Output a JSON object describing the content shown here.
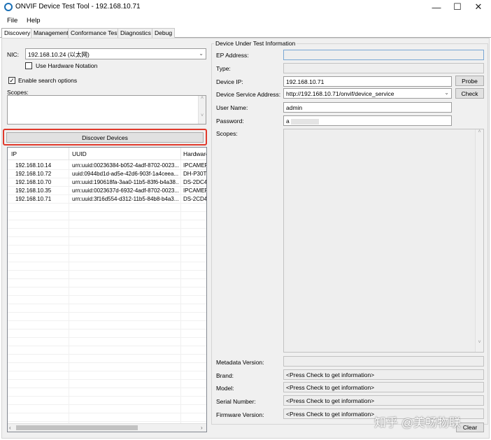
{
  "window": {
    "title": "ONVIF Device Test Tool - 192.168.10.71"
  },
  "menubar": {
    "file": "File",
    "help": "Help"
  },
  "tabs": [
    {
      "label": "Discovery"
    },
    {
      "label": "Management"
    },
    {
      "label": "Conformance Test"
    },
    {
      "label": "Diagnostics"
    },
    {
      "label": "Debug"
    }
  ],
  "discovery": {
    "nic_label": "NIC:",
    "nic_value": "192.168.10.24 (以太网)",
    "use_hw_notation": "Use Hardware Notation",
    "enable_search": "Enable search options",
    "scopes_label": "Scopes:",
    "discover_button": "Discover Devices",
    "columns": [
      "IP",
      "UUID",
      "Hardware"
    ],
    "devices": [
      {
        "ip": "192.168.10.14",
        "uuid": "urn:uuid:00236384-b052-4adf-8702-0023...",
        "hw": "IPCAMERA"
      },
      {
        "ip": "192.168.10.72",
        "uuid": "uuid:0944bd1d-ad5e-42d6-903f-1a4ceea...",
        "hw": "DH-P30T"
      },
      {
        "ip": "192.168.10.70",
        "uuid": "urn:uuid:190618fa-3aa0-11b5-83f6-b4a38...",
        "hw": "DS-2DC4"
      },
      {
        "ip": "192.168.10.35",
        "uuid": "urn:uuid:0023637d-6932-4adf-8702-0023...",
        "hw": "IPCAMERA"
      },
      {
        "ip": "192.168.10.71",
        "uuid": "urn:uuid:3f16d554-d312-11b5-84b8-b4a3...",
        "hw": "DS-2CD4"
      }
    ]
  },
  "dut": {
    "group_title": "Device Under Test Information",
    "ep_address_label": "EP Address:",
    "type_label": "Type:",
    "device_ip_label": "Device IP:",
    "device_ip_value": "192.168.10.71",
    "probe_button": "Probe",
    "service_address_label": "Device Service Address:",
    "service_address_value": "http://192.168.10.71/onvif/device_service",
    "check_button": "Check",
    "username_label": "User Name:",
    "username_value": "admin",
    "password_label": "Password:",
    "password_value": "a",
    "scopes_label": "Scopes:",
    "metadata_label": "Metadata Version:",
    "brand_label": "Brand:",
    "brand_value": "<Press Check to get information>",
    "model_label": "Model:",
    "model_value": "<Press Check to get information>",
    "serial_label": "Serial Number:",
    "serial_value": "<Press Check to get information>",
    "firmware_label": "Firmware Version:",
    "firmware_value": "<Press Check to get information>",
    "clear_button": "Clear"
  },
  "watermark": "知乎 @美畅物联",
  "colors": {
    "accent": "#1a6fb5",
    "highlight": "#e0392b"
  }
}
